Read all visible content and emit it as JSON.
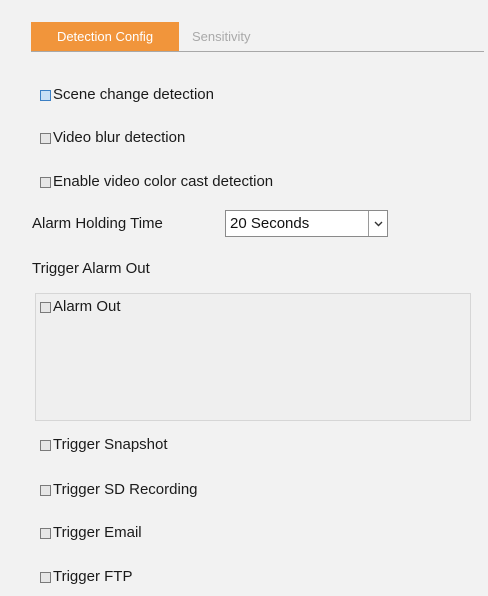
{
  "tabs": [
    {
      "label": "Detection Config",
      "active": true
    },
    {
      "label": "Sensitivity",
      "active": false
    }
  ],
  "options": {
    "scene_change": "Scene change detection",
    "video_blur": "Video blur detection",
    "color_cast": "Enable video color cast detection"
  },
  "alarm_holding": {
    "label": "Alarm Holding Time",
    "value": "20 Seconds"
  },
  "trigger_alarm_out": {
    "heading": "Trigger Alarm Out",
    "alarm_out_label": "Alarm Out"
  },
  "triggers": {
    "snapshot": "Trigger Snapshot",
    "sd_recording": "Trigger SD Recording",
    "email": "Trigger Email",
    "ftp": "Trigger FTP"
  },
  "colors": {
    "active_tab": "#f1953b",
    "background": "#f2f2f2",
    "inactive_tab_text": "#a9a9a9"
  },
  "icons": {
    "dropdown": "chevron-down-icon"
  }
}
